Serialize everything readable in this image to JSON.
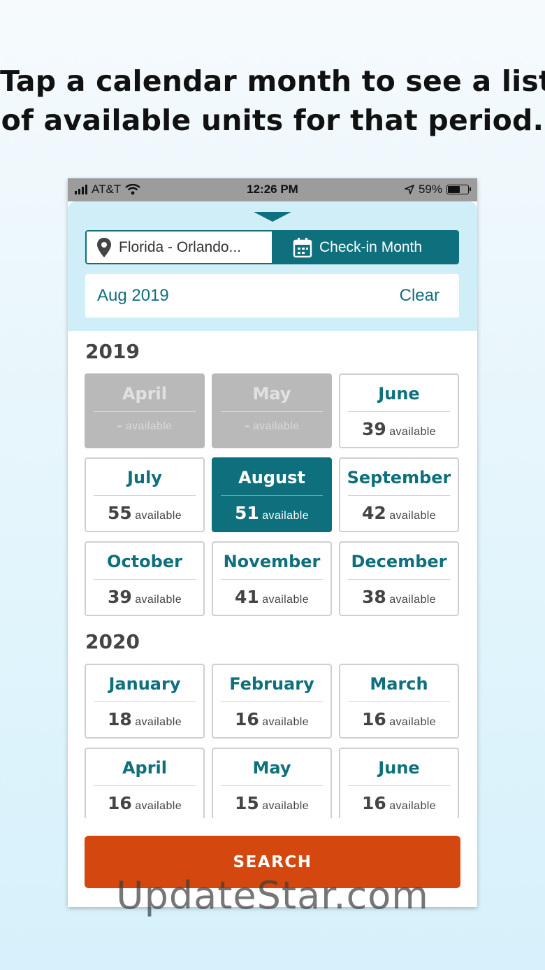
{
  "headline": {
    "line1": "Tap a calendar month to see a list",
    "line2": "of available units for that period."
  },
  "status_bar": {
    "carrier": "AT&T",
    "time": "12:26 PM",
    "battery": "59%",
    "battery_level": 0.59
  },
  "search_panel": {
    "location": "Florida - Orlando...",
    "month_tab": "Check-in Month",
    "selected_date": "Aug 2019",
    "clear_label": "Clear"
  },
  "years": [
    {
      "year": "2019",
      "months": [
        {
          "name": "April",
          "count": "–",
          "label": "available",
          "state": "disabled"
        },
        {
          "name": "May",
          "count": "–",
          "label": "available",
          "state": "disabled"
        },
        {
          "name": "June",
          "count": "39",
          "label": "available",
          "state": "normal"
        },
        {
          "name": "July",
          "count": "55",
          "label": "available",
          "state": "normal"
        },
        {
          "name": "August",
          "count": "51",
          "label": "available",
          "state": "selected"
        },
        {
          "name": "September",
          "count": "42",
          "label": "available",
          "state": "normal"
        },
        {
          "name": "October",
          "count": "39",
          "label": "available",
          "state": "normal"
        },
        {
          "name": "November",
          "count": "41",
          "label": "available",
          "state": "normal"
        },
        {
          "name": "December",
          "count": "38",
          "label": "available",
          "state": "normal"
        }
      ]
    },
    {
      "year": "2020",
      "months": [
        {
          "name": "January",
          "count": "18",
          "label": "available",
          "state": "normal"
        },
        {
          "name": "February",
          "count": "16",
          "label": "available",
          "state": "normal"
        },
        {
          "name": "March",
          "count": "16",
          "label": "available",
          "state": "normal"
        },
        {
          "name": "April",
          "count": "16",
          "label": "available",
          "state": "normal"
        },
        {
          "name": "May",
          "count": "15",
          "label": "available",
          "state": "normal"
        },
        {
          "name": "June",
          "count": "16",
          "label": "available",
          "state": "normal"
        }
      ]
    }
  ],
  "search_button": "SEARCH",
  "watermark": "UpdateStar.com",
  "colors": {
    "accent": "#0e6f7d",
    "search": "#d4470f",
    "disabled": "#b9b9b9",
    "panel": "#cfeef8"
  },
  "icons": [
    "cellular-signal-icon",
    "wifi-icon",
    "location-arrow-icon",
    "battery-icon",
    "map-pin-icon",
    "calendar-icon",
    "dropdown-triangle-icon"
  ]
}
